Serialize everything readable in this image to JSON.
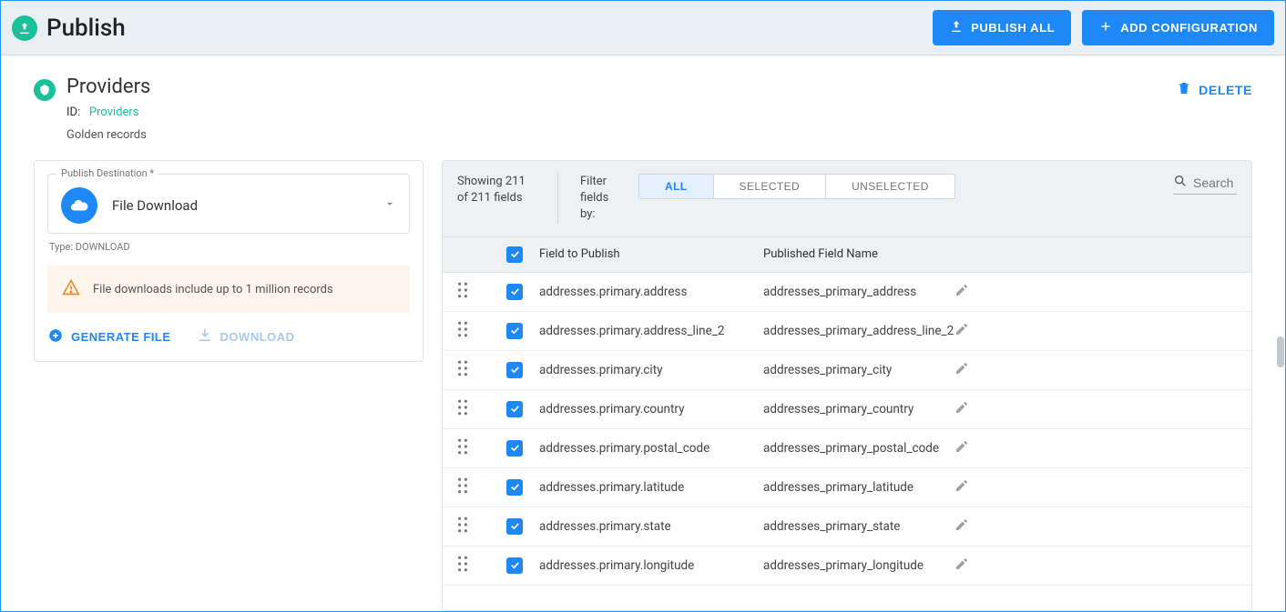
{
  "header": {
    "title": "Publish",
    "publish_all": "PUBLISH ALL",
    "add_config": "ADD CONFIGURATION"
  },
  "section": {
    "title": "Providers",
    "id_label": "ID:",
    "id_value": "Providers",
    "desc": "Golden records",
    "delete": "DELETE"
  },
  "destination": {
    "label": "Publish Destination *",
    "value": "File Download",
    "type_label": "Type: DOWNLOAD"
  },
  "warning": "File downloads include up to 1 million records",
  "actions": {
    "generate": "GENERATE FILE",
    "download": "DOWNLOAD"
  },
  "filter": {
    "count": "Showing 211 of 211 fields",
    "label": "Filter fields by:",
    "tabs": {
      "all": "ALL",
      "selected": "SELECTED",
      "unselected": "UNSELECTED"
    },
    "search_placeholder": "Search"
  },
  "columns": {
    "field": "Field to Publish",
    "published": "Published Field Name"
  },
  "rows": [
    {
      "field": "addresses.primary.address",
      "published": "addresses_primary_address"
    },
    {
      "field": "addresses.primary.address_line_2",
      "published": "addresses_primary_address_line_2"
    },
    {
      "field": "addresses.primary.city",
      "published": "addresses_primary_city"
    },
    {
      "field": "addresses.primary.country",
      "published": "addresses_primary_country"
    },
    {
      "field": "addresses.primary.postal_code",
      "published": "addresses_primary_postal_code"
    },
    {
      "field": "addresses.primary.latitude",
      "published": "addresses_primary_latitude"
    },
    {
      "field": "addresses.primary.state",
      "published": "addresses_primary_state"
    },
    {
      "field": "addresses.primary.longitude",
      "published": "addresses_primary_longitude"
    }
  ]
}
